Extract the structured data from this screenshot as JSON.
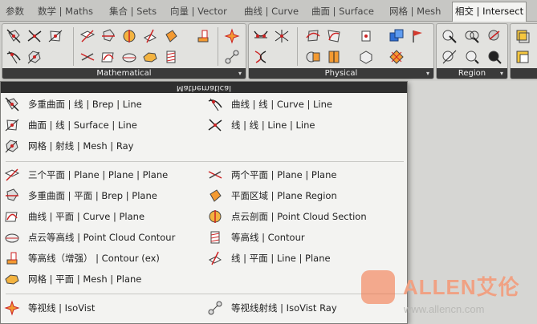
{
  "tabs": [
    {
      "label": "参数"
    },
    {
      "label": "数学 | Maths"
    },
    {
      "label": "集合 | Sets"
    },
    {
      "label": "向量 | Vector"
    },
    {
      "label": "曲线 | Curve"
    },
    {
      "label": "曲面 | Surface"
    },
    {
      "label": "网格 | Mesh"
    },
    {
      "label": "相交 | Intersect",
      "active": true
    }
  ],
  "ribbon": {
    "groups": [
      {
        "label": "Mathematical",
        "icon_count": 20
      },
      {
        "label": "Physical",
        "icon_count": 10
      },
      {
        "label": "Region",
        "icon_count": 6
      },
      {
        "label": "",
        "icon_count": 2
      }
    ],
    "dropdown_arrow": "▾"
  },
  "dropdown": {
    "title": "Mathematical",
    "sections": [
      {
        "left": [
          {
            "icon": "brep-line-icon",
            "label": "多重曲面 | 线 | Brep | Line"
          },
          {
            "icon": "surface-line-icon",
            "label": "曲面 | 线 | Surface | Line"
          },
          {
            "icon": "mesh-ray-icon",
            "label": "网格 | 射线 | Mesh | Ray"
          }
        ],
        "right": [
          {
            "icon": "curve-line-icon",
            "label": "曲线 | 线 | Curve | Line"
          },
          {
            "icon": "line-line-icon",
            "label": "线 | 线 | Line | Line"
          }
        ]
      },
      {
        "left": [
          {
            "icon": "plane-plane-plane-icon",
            "label": "三个平面 | Plane | Plane | Plane"
          },
          {
            "icon": "brep-plane-icon",
            "label": "多重曲面 | 平面 | Brep | Plane"
          },
          {
            "icon": "curve-plane-icon",
            "label": "曲线 | 平面 | Curve | Plane"
          },
          {
            "icon": "point-cloud-contour-icon",
            "label": "点云等高线 | Point Cloud Contour"
          },
          {
            "icon": "contour-ex-icon",
            "label": "等高线（增强） | Contour (ex)"
          },
          {
            "icon": "mesh-plane-icon",
            "label": "网格 | 平面 | Mesh | Plane"
          }
        ],
        "right": [
          {
            "icon": "plane-plane-icon",
            "label": "两个平面 | Plane | Plane"
          },
          {
            "icon": "plane-region-icon",
            "label": "平面区域 | Plane Region"
          },
          {
            "icon": "point-cloud-section-icon",
            "label": "点云剖面 | Point Cloud Section"
          },
          {
            "icon": "contour-icon",
            "label": "等高线 | Contour"
          },
          {
            "icon": "line-plane-icon",
            "label": "线 | 平面 | Line | Plane"
          }
        ]
      },
      {
        "left": [
          {
            "icon": "isovist-icon",
            "label": "等视线 | IsoVist"
          }
        ],
        "right": [
          {
            "icon": "isovist-ray-icon",
            "label": "等视线射线 | IsoVist Ray"
          }
        ]
      }
    ]
  },
  "watermark": {
    "brand": "ALLEN艾伦",
    "url": "www.allencn.com"
  }
}
